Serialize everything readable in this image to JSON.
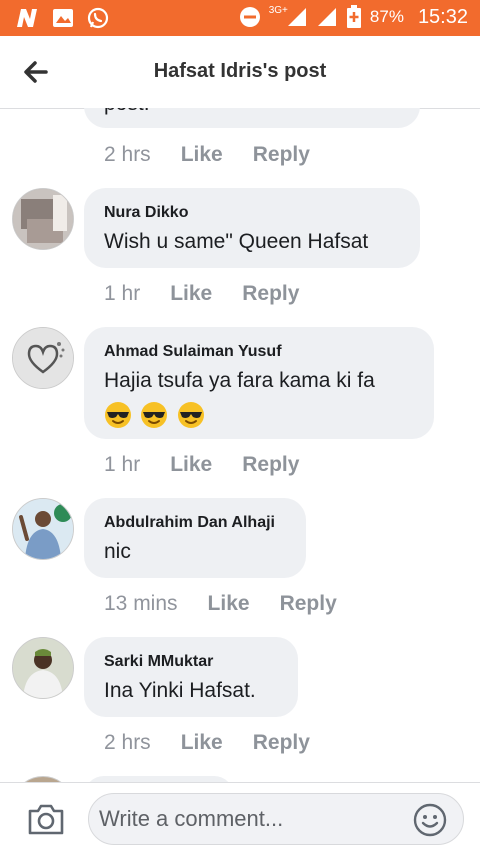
{
  "status_bar": {
    "network": "3G+",
    "battery": "87%",
    "time": "15:32"
  },
  "header": {
    "title": "Hafsat Idris's post"
  },
  "comments": [
    {
      "author": "",
      "text": "post.",
      "time": "2 hrs",
      "like": "Like",
      "reply": "Reply"
    },
    {
      "author": "Nura Dikko",
      "text": "Wish u same\" Queen Hafsat",
      "time": "1 hr",
      "like": "Like",
      "reply": "Reply"
    },
    {
      "author": "Ahmad Sulaiman Yusuf",
      "text": "Hajia tsufa ya fara kama ki fa",
      "emojis": [
        "sunglasses-face",
        "sunglasses-face",
        "sunglasses-face"
      ],
      "time": "1 hr",
      "like": "Like",
      "reply": "Reply"
    },
    {
      "author": "Abdulrahim Dan Alhaji",
      "text": "nic",
      "time": "13 mins",
      "like": "Like",
      "reply": "Reply"
    },
    {
      "author": "Sarki MMuktar",
      "text": "Ina Yinki Hafsat.",
      "time": "2 hrs",
      "like": "Like",
      "reply": "Reply"
    }
  ],
  "composer": {
    "placeholder": "Write a comment..."
  },
  "colors": {
    "status_bar": "#f26b2d",
    "bubble": "#eef0f3",
    "meta": "#90949c"
  }
}
